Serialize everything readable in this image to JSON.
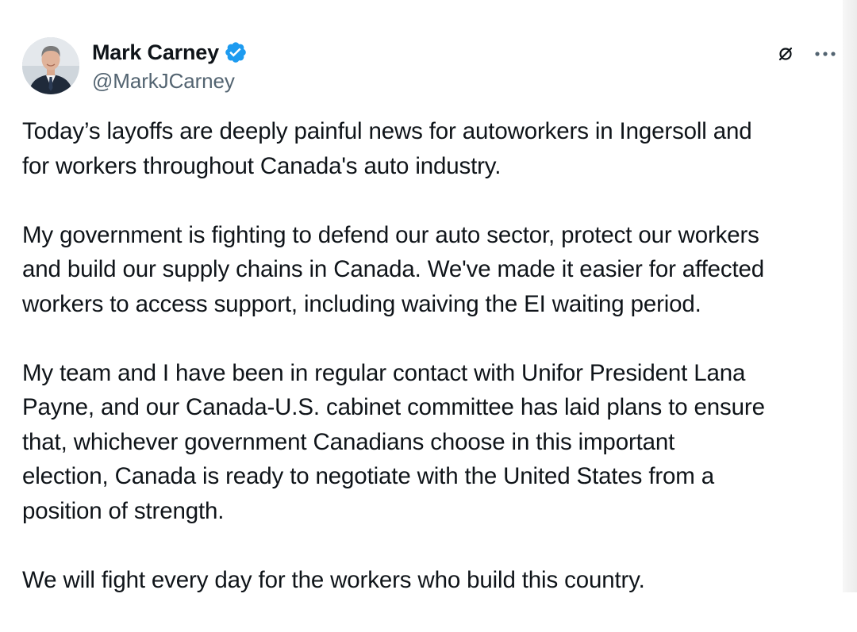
{
  "author": {
    "name": "Mark Carney",
    "handle": "@MarkJCarney",
    "verified_icon": "verified-badge-icon",
    "verified_color": "#1d9bf0",
    "avatar_icon": "profile-photo"
  },
  "actions": {
    "grok_icon": "grok-icon",
    "more_icon": "more-options-icon"
  },
  "post": {
    "paragraphs": [
      {
        "lines": [
          "Today’s layoffs are deeply painful news for autoworkers in Ingersoll and",
          "for workers throughout Canada's auto industry."
        ]
      },
      {
        "lines": [
          "My government is fighting to defend our auto sector, protect our workers",
          "and build our supply chains in Canada. We've made it easier for affected",
          "workers to access support, including waiving the EI waiting period."
        ]
      },
      {
        "lines": [
          "My team and I have been in regular contact with Unifor President Lana",
          "Payne, and our Canada-U.S. cabinet committee has laid plans to ensure",
          "that, whichever government Canadians choose in this important",
          "election, Canada is ready to negotiate with the United States from a",
          "position of strength."
        ]
      },
      {
        "lines": [
          "We will fight every day for the workers who build this country."
        ]
      }
    ]
  },
  "colors": {
    "text": "#0f1419",
    "secondary": "#536471",
    "accent": "#1d9bf0"
  }
}
